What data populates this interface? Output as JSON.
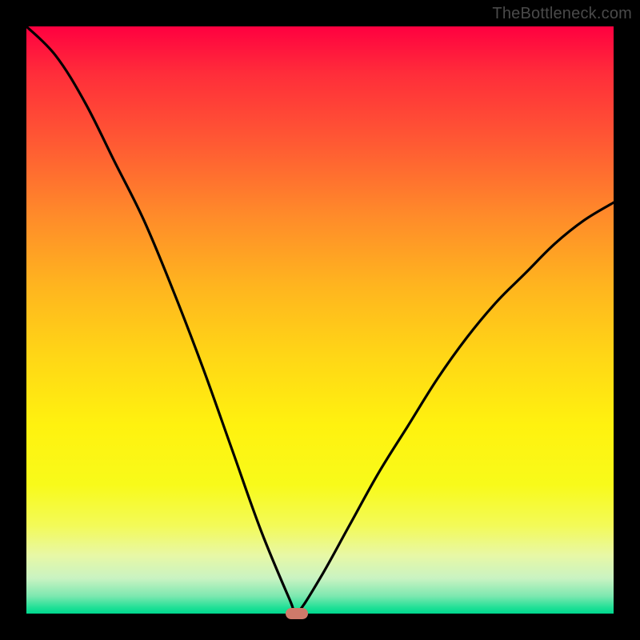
{
  "attribution": "TheBottleneck.com",
  "colors": {
    "frame": "#000000",
    "curve": "#000000",
    "marker": "#cf7a6a",
    "gradient_top": "#ff0040",
    "gradient_bottom": "#00d88f"
  },
  "chart_data": {
    "type": "line",
    "title": "",
    "xlabel": "",
    "ylabel": "",
    "xlim": [
      0,
      100
    ],
    "ylim": [
      0,
      100
    ],
    "x": [
      0,
      5,
      10,
      15,
      20,
      25,
      30,
      35,
      40,
      45,
      46,
      50,
      55,
      60,
      65,
      70,
      75,
      80,
      85,
      90,
      95,
      100
    ],
    "values": [
      100,
      95,
      87,
      77,
      67,
      55,
      42,
      28,
      14,
      2,
      0,
      6,
      15,
      24,
      32,
      40,
      47,
      53,
      58,
      63,
      67,
      70
    ],
    "marker": {
      "x": 46,
      "y": 0
    },
    "note": "Bottleneck-style V curve; y=0 is optimal (bottom, green), y=100 is worst (top, red). Minimum near x≈46."
  }
}
